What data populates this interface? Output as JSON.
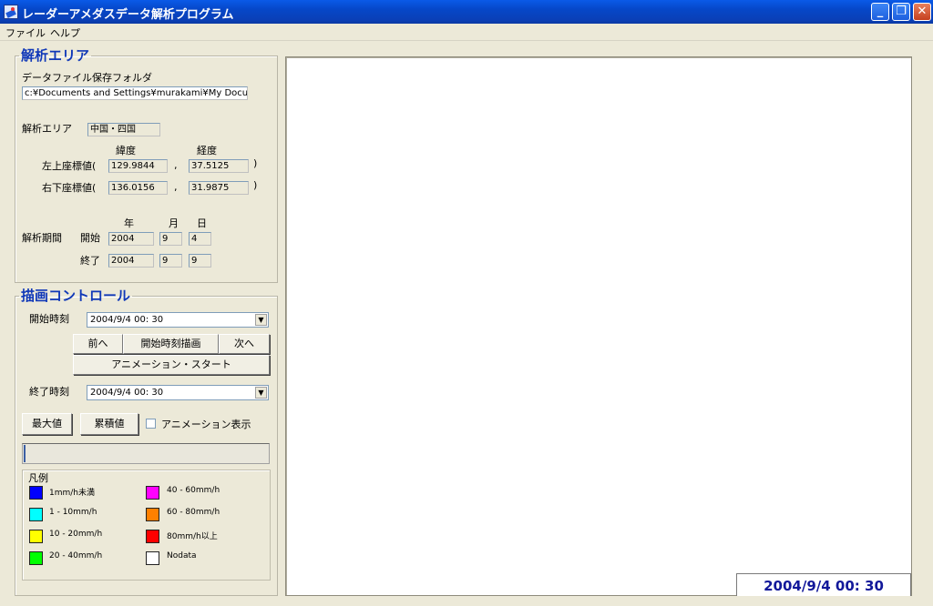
{
  "window": {
    "title": "レーダーアメダスデータ解析プログラム"
  },
  "menu": {
    "items": [
      "ファイル",
      "ヘルプ"
    ]
  },
  "analysis_area": {
    "group_title": "解析エリア",
    "folder_label": "データファイル保存フォルダ",
    "folder_value": "c:¥Documents and Settings¥murakami¥My Docu",
    "area_label": "解析エリア",
    "area_value": "中国・四国",
    "lat_header": "緯度",
    "lon_header": "経度",
    "upper_left_label": "左上座標値(",
    "upper_left_lat": "129.9844",
    "upper_left_lon": "37.5125",
    "lower_right_label": "右下座標値(",
    "lower_right_lat": "136.0156",
    "lower_right_lon": "31.9875",
    "comma": ",",
    "close_paren": ")",
    "period_label": "解析期間",
    "year_header": "年",
    "month_header": "月",
    "day_header": "日",
    "start_label": "開始",
    "start_year": "2004",
    "start_month": "9",
    "start_day": "4",
    "end_label": "終了",
    "end_year": "2004",
    "end_month": "9",
    "end_day": "9"
  },
  "draw_control": {
    "group_title": "描画コントロール",
    "start_time_label": "開始時刻",
    "start_time_value": "2004/9/4 00: 30",
    "prev_button": "前へ",
    "draw_start_button": "開始時刻描画",
    "next_button": "次へ",
    "animation_start_button": "アニメーション・スタート",
    "end_time_label": "終了時刻",
    "end_time_value": "2004/9/4 00: 30",
    "max_button": "最大値",
    "cumulative_button": "累積値",
    "animation_display_label": "アニメーション表示",
    "animation_display_checked": false
  },
  "legend": {
    "title": "凡例",
    "items": [
      {
        "label": "1mm/h未満",
        "color": "#0000ff"
      },
      {
        "label": "1 - 10mm/h",
        "color": "#00ffff"
      },
      {
        "label": "10 - 20mm/h",
        "color": "#ffff00"
      },
      {
        "label": "20 - 40mm/h",
        "color": "#00ff00"
      },
      {
        "label": "40 - 60mm/h",
        "color": "#ff00ff"
      },
      {
        "label": "60 - 80mm/h",
        "color": "#ff8000"
      },
      {
        "label": "80mm/h以上",
        "color": "#ff0000"
      },
      {
        "label": "Nodata",
        "color": "#ffffff"
      }
    ]
  },
  "display": {
    "timestamp": "2004/9/4 00: 30"
  }
}
